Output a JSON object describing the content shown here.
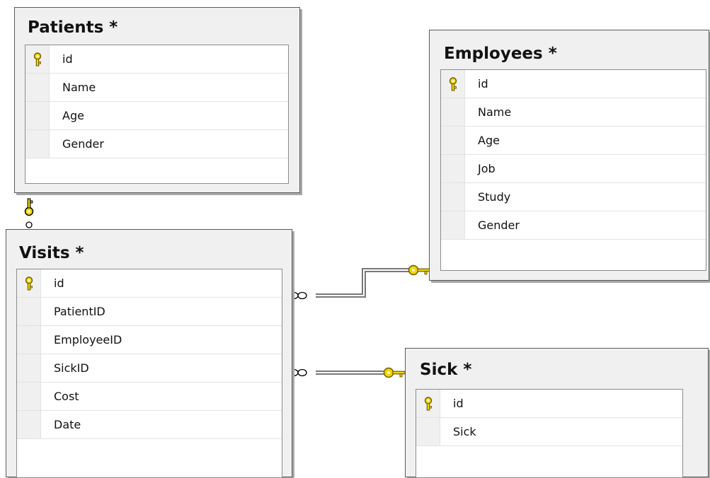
{
  "tables": {
    "patients": {
      "title": "Patients *",
      "columns": [
        {
          "name": "id",
          "primary_key": true
        },
        {
          "name": "Name",
          "primary_key": false
        },
        {
          "name": "Age",
          "primary_key": false
        },
        {
          "name": "Gender",
          "primary_key": false
        }
      ]
    },
    "employees": {
      "title": "Employees *",
      "columns": [
        {
          "name": "id",
          "primary_key": true
        },
        {
          "name": "Name",
          "primary_key": false
        },
        {
          "name": "Age",
          "primary_key": false
        },
        {
          "name": "Job",
          "primary_key": false
        },
        {
          "name": "Study",
          "primary_key": false
        },
        {
          "name": "Gender",
          "primary_key": false
        }
      ]
    },
    "visits": {
      "title": "Visits *",
      "columns": [
        {
          "name": "id",
          "primary_key": true
        },
        {
          "name": "PatientID",
          "primary_key": false
        },
        {
          "name": "EmployeeID",
          "primary_key": false
        },
        {
          "name": "SickID",
          "primary_key": false
        },
        {
          "name": "Cost",
          "primary_key": false
        },
        {
          "name": "Date",
          "primary_key": false
        }
      ]
    },
    "sick": {
      "title": "Sick *",
      "columns": [
        {
          "name": "id",
          "primary_key": true
        },
        {
          "name": "Sick",
          "primary_key": false
        }
      ]
    }
  },
  "relationships": [
    {
      "from": "visits",
      "to": "patients",
      "many_end": "visits",
      "one_end": "patients"
    },
    {
      "from": "visits",
      "to": "employees",
      "many_end": "visits",
      "one_end": "employees"
    },
    {
      "from": "visits",
      "to": "sick",
      "many_end": "visits",
      "one_end": "sick"
    }
  ],
  "colors": {
    "key": "#f2d600",
    "key_outline": "#6b5a00",
    "relationship_line": "#777777",
    "box_background": "#f0f0f0"
  },
  "icons": {
    "primary_key": "key-icon",
    "one_end": "key-icon",
    "many_end": "infinity-icon"
  }
}
